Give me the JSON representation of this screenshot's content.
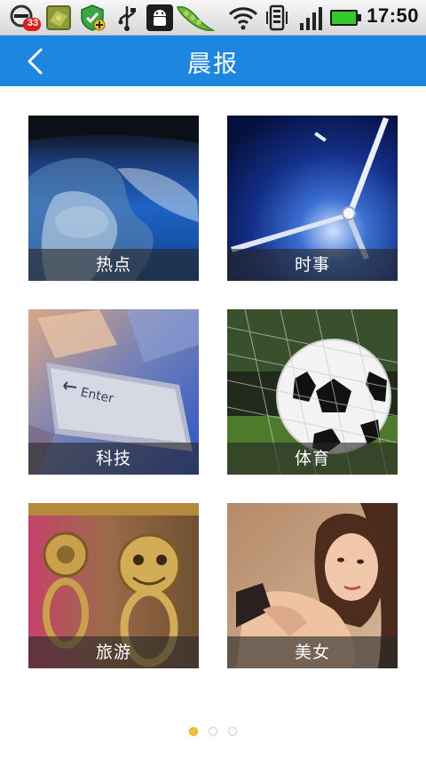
{
  "status_bar": {
    "time": "17:50",
    "notification_count": "33",
    "icons": [
      "app-badge-icon",
      "map-icon",
      "shield-check-icon",
      "usb-icon",
      "android-debug-icon",
      "peapod-icon",
      "wifi-icon",
      "vibrate-icon",
      "signal-icon",
      "battery-icon"
    ]
  },
  "header": {
    "title": "晨报",
    "back_icon": "back-chevron-icon"
  },
  "tiles": [
    {
      "label": "热点",
      "image": "earth-from-space"
    },
    {
      "label": "时事",
      "image": "clock-hands"
    },
    {
      "label": "科技",
      "image": "keyboard-enter-key"
    },
    {
      "label": "体育",
      "image": "soccer-ball-in-net"
    },
    {
      "label": "旅游",
      "image": "bronze-lion-door-knockers"
    },
    {
      "label": "美女",
      "image": "woman-portrait"
    }
  ],
  "pager": {
    "pages": 3,
    "active": 1
  },
  "colors": {
    "accent": "#1d86e0",
    "pager_active": "#f1c233",
    "caption_bg": "#282828"
  }
}
